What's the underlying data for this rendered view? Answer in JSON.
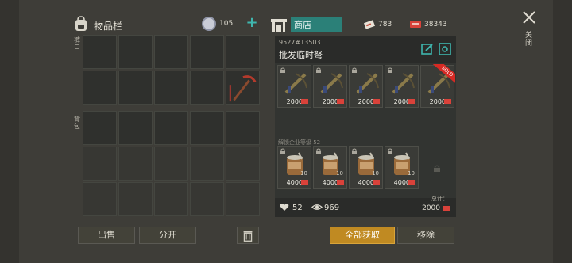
{
  "inventory": {
    "title": "物品栏",
    "coins": "105",
    "plus": "+",
    "pocket_label": "裤口",
    "backpack_label": "背包"
  },
  "actions": {
    "sell": "出售",
    "split": "分开",
    "get_all": "全部获取",
    "remove": "移除"
  },
  "shop": {
    "tab_label": "商店",
    "tickets": "783",
    "cards": "38343",
    "stall_id": "9527#13503",
    "stall_name": "批发临时弩",
    "unlock_note": "解锁企业等级 52",
    "likes": "52",
    "views": "969",
    "total_label": "总计：",
    "total_value": "2000",
    "items": [
      {
        "name": "crossbow",
        "price": "2000",
        "sold": false
      },
      {
        "name": "crossbow",
        "price": "2000",
        "sold": false
      },
      {
        "name": "crossbow",
        "price": "2000",
        "sold": false
      },
      {
        "name": "crossbow",
        "price": "2000",
        "sold": false
      },
      {
        "name": "crossbow",
        "price": "2000",
        "sold": true,
        "sold_label": "SOLD"
      },
      {
        "name": "canned-food",
        "price": "4000",
        "qty": "10"
      },
      {
        "name": "canned-food",
        "price": "4000",
        "qty": "10"
      },
      {
        "name": "canned-food",
        "price": "4000",
        "qty": "10"
      },
      {
        "name": "canned-food",
        "price": "4000",
        "qty": "10"
      }
    ]
  },
  "close": {
    "label": "关闭"
  },
  "colors": {
    "accent_teal": "#2b8078",
    "gold_button": "#c08a22",
    "sold_red": "#d62a24"
  }
}
